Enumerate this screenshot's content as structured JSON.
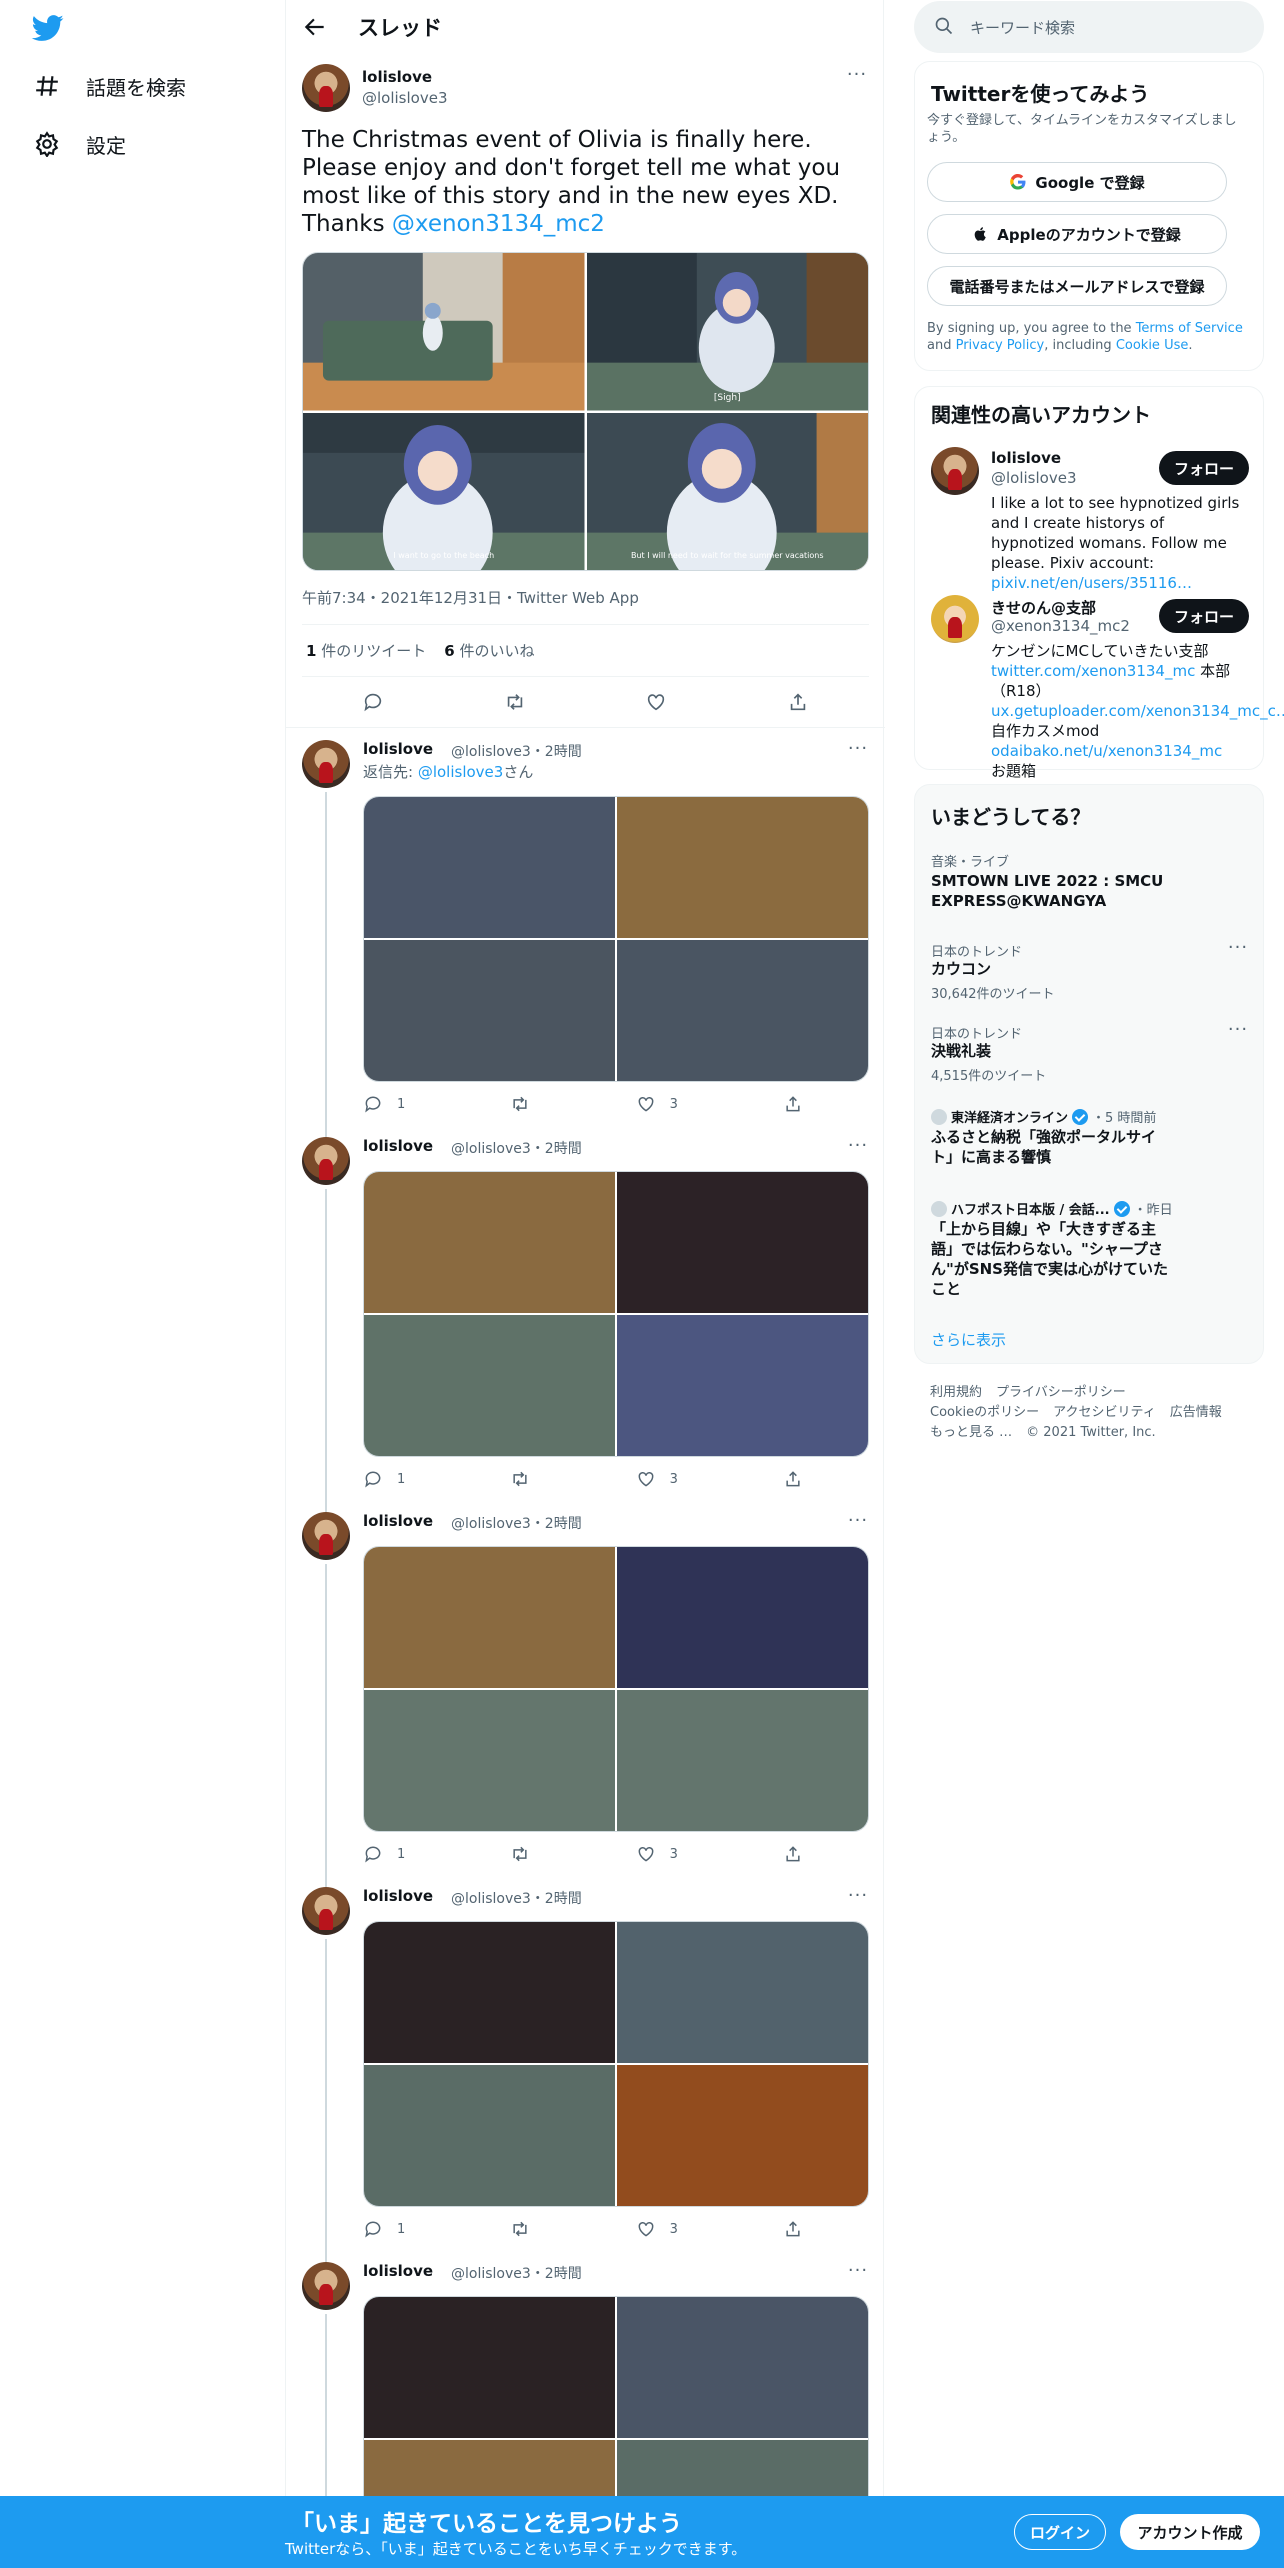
{
  "nav": {
    "explore_label": "話題を検索",
    "settings_label": "設定"
  },
  "header": {
    "title": "スレッド"
  },
  "main_tweet": {
    "name": "lolislove",
    "handle": "@lolislove3",
    "text": "The Christmas event of Olivia is finally here. Please enjoy and don't forget tell me what you most like of this story and in the new eyes XD. Thanks",
    "mention": "@xenon3134_mc2",
    "subtitles": [
      "[Sigh]",
      "I want to go to the beach",
      "But I will need to wait for the summer vacations"
    ],
    "timestamp": "午前7:34・2021年12月31日・Twitter Web App",
    "retweets_count": "1",
    "retweets_label": "件のリツイート",
    "likes_count": "6",
    "likes_label": "件のいいね"
  },
  "replies": [
    {
      "name": "lolislove",
      "handle": "@lolislove3",
      "time": "・2時間",
      "reply_prefix": "返信先: ",
      "reply_to": "@lolislove3",
      "reply_suffix": "さん",
      "reply_count": "1",
      "like_count": "3",
      "colors": [
        "#4a5568",
        "#8b6b3f",
        "#4b5560",
        "#4a5562"
      ]
    },
    {
      "name": "lolislove",
      "handle": "@lolislove3",
      "time": "・2時間",
      "reply_count": "1",
      "like_count": "3",
      "colors": [
        "#8a6a40",
        "#2c2226",
        "#5f7268",
        "#4c5680"
      ]
    },
    {
      "name": "lolislove",
      "handle": "@lolislove3",
      "time": "・2時間",
      "reply_count": "1",
      "like_count": "3",
      "colors": [
        "#8a6a40",
        "#2f3356",
        "#64766d",
        "#63756d"
      ]
    },
    {
      "name": "lolislove",
      "handle": "@lolislove3",
      "time": "・2時間",
      "reply_count": "1",
      "like_count": "3",
      "colors": [
        "#2a2224",
        "#52626c",
        "#5a6c66",
        "#924c1e"
      ]
    },
    {
      "name": "lolislove",
      "handle": "@lolislove3",
      "time": "・2時間",
      "colors": [
        "#2a2224",
        "#4a5566",
        "#8a6a40",
        "#5a6c66"
      ]
    }
  ],
  "search": {
    "placeholder": "キーワード検索"
  },
  "signup": {
    "title": "Twitterを使ってみよう",
    "subtitle": "今すぐ登録して、タイムラインをカスタマイズしましょう。",
    "google": "Google で登録",
    "apple": "Appleのアカウントで登録",
    "phone": "電話番号またはメールアドレスで登録",
    "terms_1": "By signing up, you agree to the ",
    "terms_link1": "Terms of Service",
    "terms_2": " and ",
    "terms_link2": "Privacy Policy",
    "terms_3": ", including ",
    "terms_link3": "Cookie Use",
    "terms_4": "."
  },
  "related": {
    "title": "関連性の高いアカウント",
    "follow_label": "フォロー",
    "accounts": [
      {
        "name": "lolislove",
        "handle": "@lolislove3",
        "bio": "I like a lot to see hypnotized girls and I create historys of hypnotized womans. Follow me please. Pixiv account: ",
        "bio_link": "pixiv.net/en/users/35116…"
      },
      {
        "name": "きせのん@支部",
        "handle": "@xenon3134_mc2",
        "bio_1": "ケンゼンにMCしていきたい支部",
        "link_1": "twitter.com/xenon3134_mc",
        "bio_2": " 本部（R18）",
        "link_2": "ux.getuploader.com/xenon3134_mc_c…",
        "bio_3": " 自作カスメmod ",
        "link_3": "odaibako.net/u/xenon3134_mc",
        "bio_4": " お題箱"
      }
    ]
  },
  "trends": {
    "title": "いまどうしてる？",
    "items": [
      {
        "meta": "音楽・ライブ",
        "name": "SMTOWN LIVE 2022 : SMCU EXPRESS@KWANGYA"
      },
      {
        "meta": "日本のトレンド",
        "name": "カウコン",
        "count": "30,642件のツイート"
      },
      {
        "meta": "日本のトレンド",
        "name": "決戦礼装",
        "count": "4,515件のツイート"
      }
    ],
    "news": [
      {
        "source": "東洋経済オンライン",
        "time": "・5 時間前",
        "headline": "ふるさと納税「強欲ポータルサイト」に高まる響慎"
      },
      {
        "source": "ハフポスト日本版 / 会話...",
        "time": "・昨日",
        "headline": "「上から目線」や「大きすぎる主語」では伝わらない。\"シャープさん\"がSNS発信で実は心がけていたこと"
      }
    ],
    "show_more": "さらに表示"
  },
  "footer": {
    "links": [
      "利用規約",
      "プライバシーポリシー",
      "Cookieのポリシー",
      "アクセシビリティ",
      "広告情報",
      "もっと見る …"
    ],
    "copyright": "© 2021 Twitter, Inc."
  },
  "bottom_bar": {
    "title": "「いま」起きていることを見つけよう",
    "subtitle": "Twitterなら、「いま」起きていることをいち早くチェックできます。",
    "login": "ログイン",
    "signup": "アカウント作成"
  },
  "colors": {
    "accent": "#1d9bf0",
    "text": "#0f1419",
    "muted": "#536471"
  }
}
